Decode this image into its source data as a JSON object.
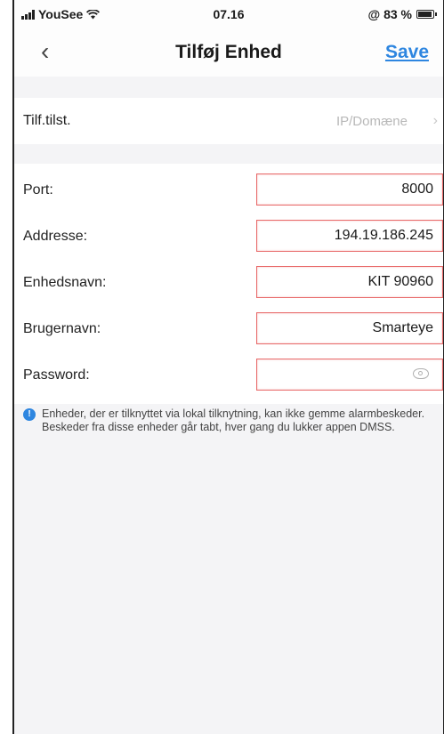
{
  "status_bar": {
    "carrier": "YouSee",
    "time": "07.16",
    "battery": "@ 83 %",
    "battery_level": 0.83
  },
  "nav": {
    "back_icon": "chevron-left-icon",
    "title": "Tilføj Enhed",
    "save_label": "Save"
  },
  "mode_row": {
    "label": "Tilf.tilst.",
    "value": "IP/Domæne"
  },
  "fields": {
    "port": {
      "label": "Port:",
      "value": "8000"
    },
    "address": {
      "label": "Addresse:",
      "value": "194.19.186.245"
    },
    "device_name": {
      "label": "Enhedsnavn:",
      "value": "KIT 90960"
    },
    "username": {
      "label": "Brugernavn:",
      "value": "Smarteye"
    },
    "password": {
      "label": "Password:",
      "value": ""
    }
  },
  "note": {
    "icon": "info-icon",
    "text": "Enheder, der er tilknyttet via lokal tilknytning, kan ikke gemme alarmbeskeder. Beskeder fra disse enheder går tabt, hver gang du lukker appen DMSS."
  },
  "colors": {
    "accent": "#2e86e0",
    "field_border": "#e86a6a",
    "background": "#f4f4f6"
  }
}
